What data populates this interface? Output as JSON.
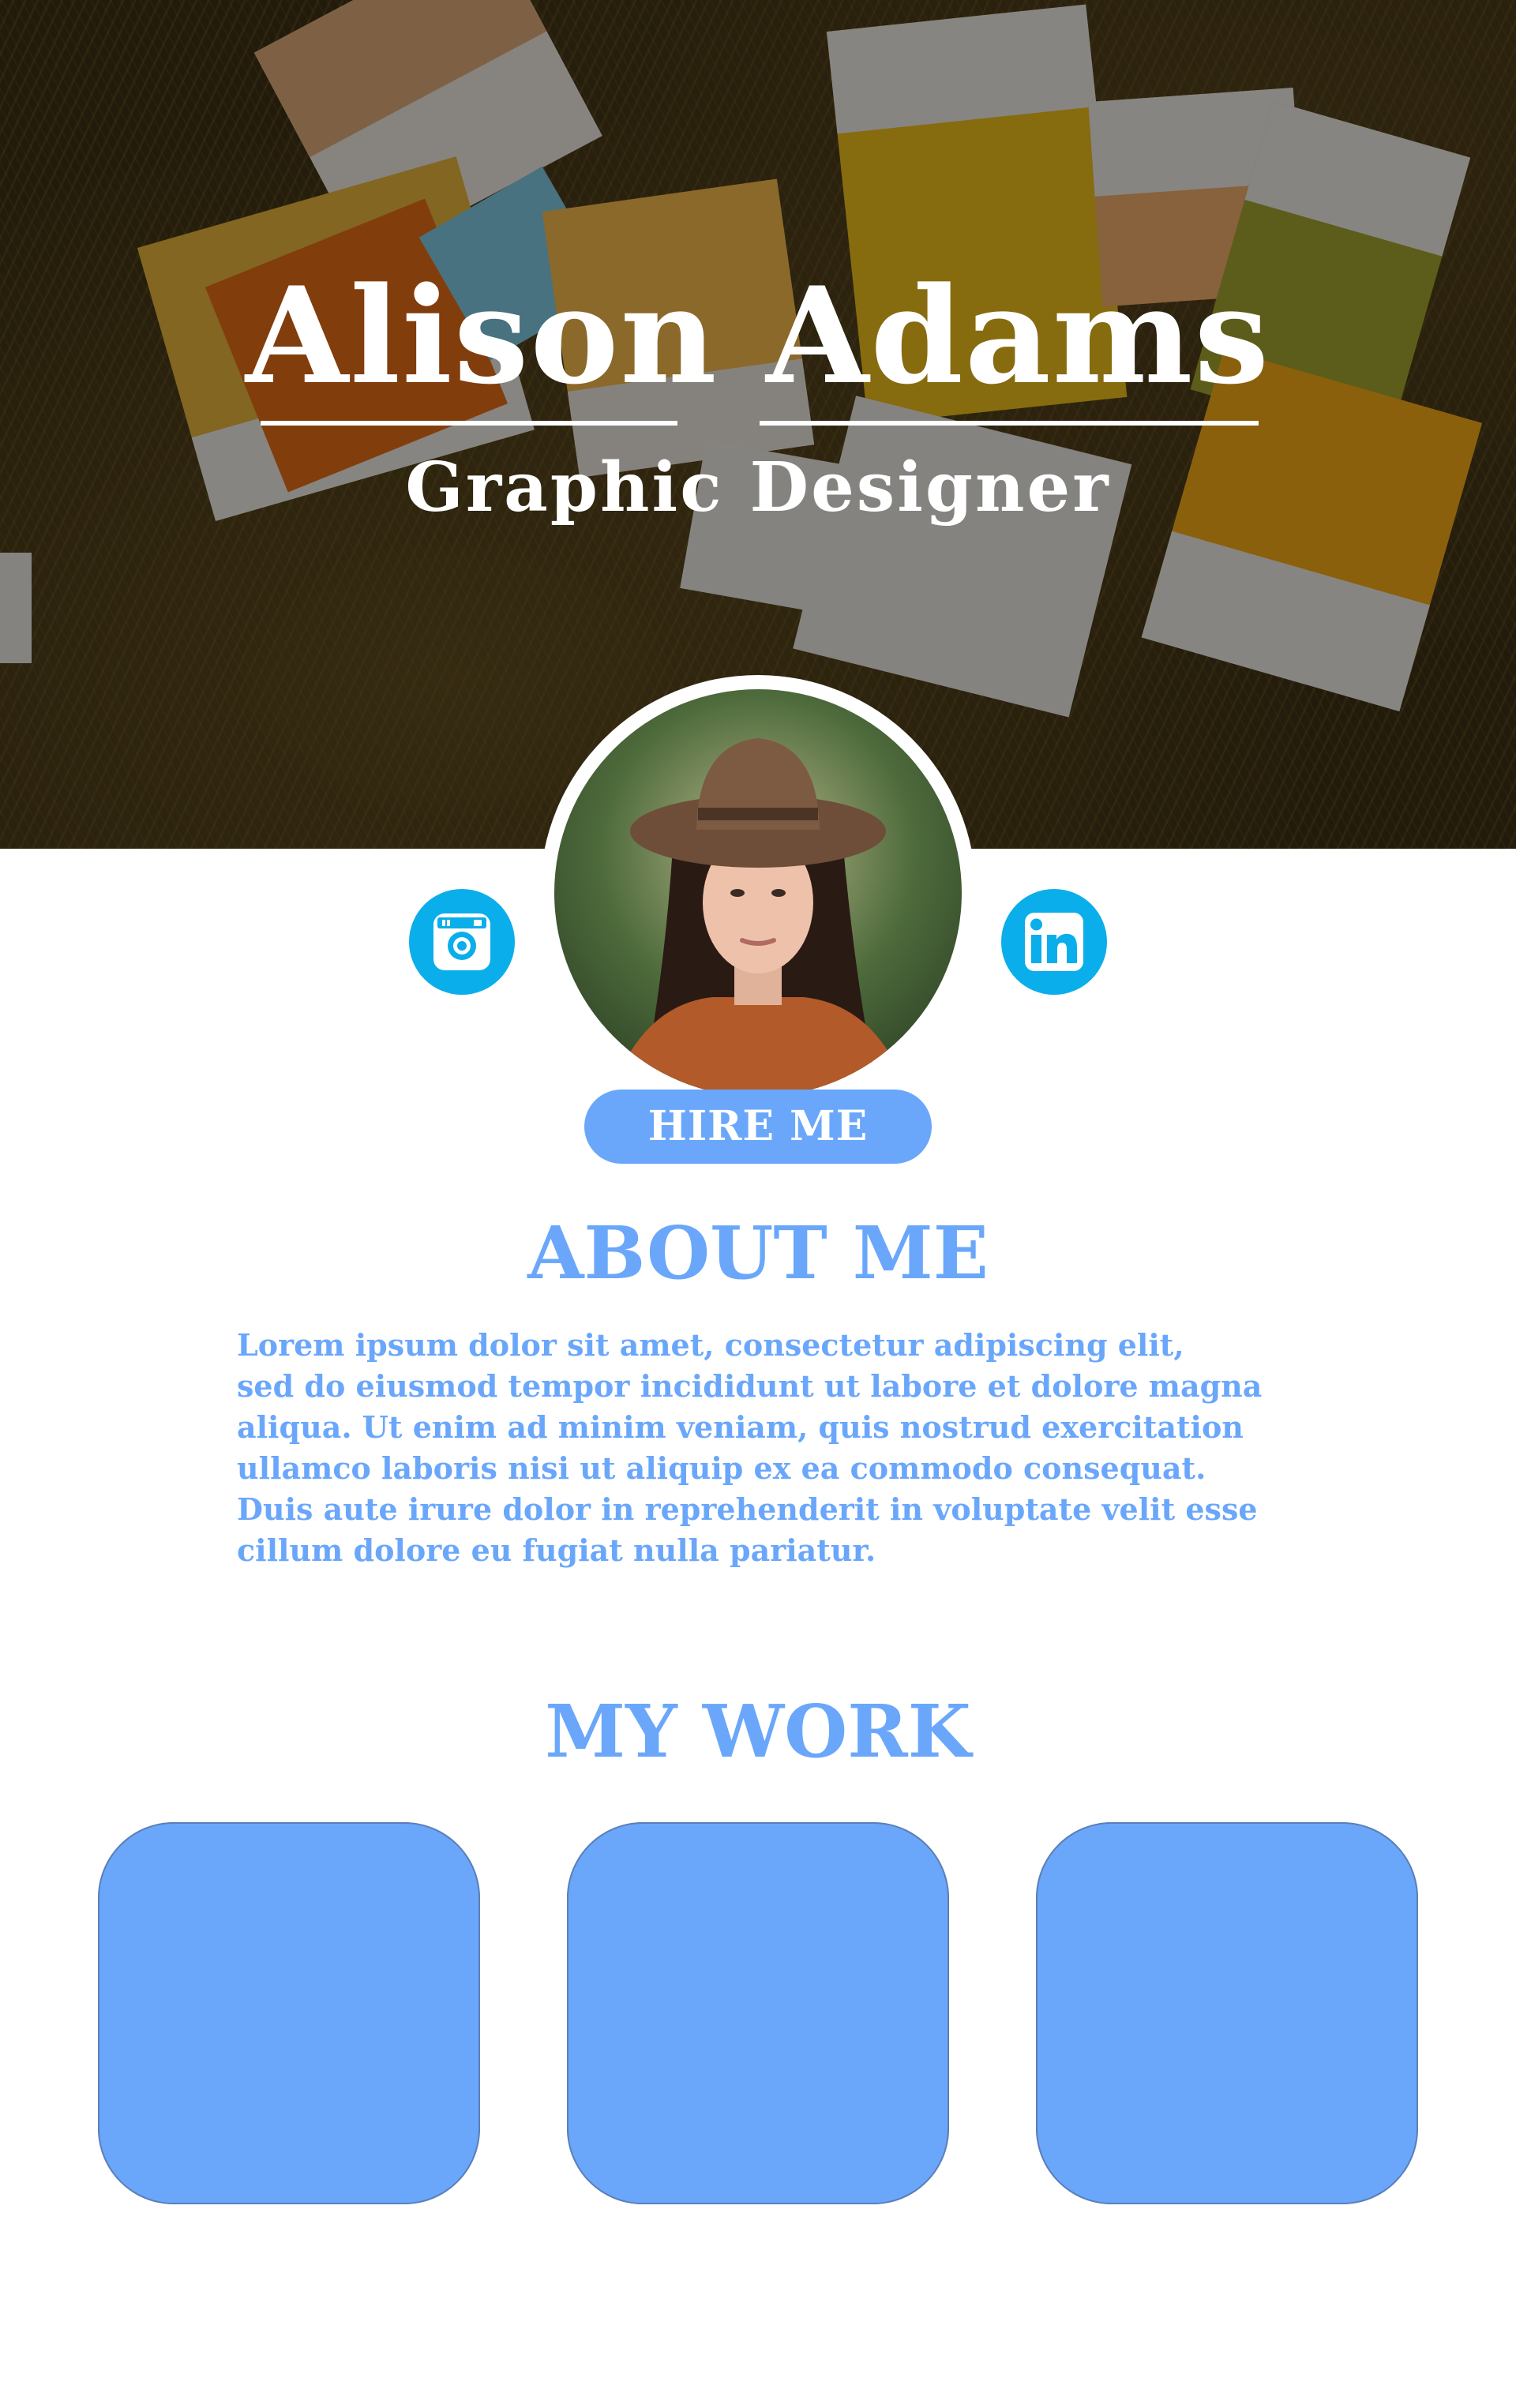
{
  "hero": {
    "name": "Alison Adams",
    "role": "Graphic Designer"
  },
  "social": {
    "links": [
      {
        "name": "instagram",
        "icon": "instagram-icon"
      },
      {
        "name": "linkedin",
        "icon": "linkedin-icon"
      }
    ],
    "color": "#0aaeea"
  },
  "hire": {
    "label": "HIRE ME"
  },
  "about": {
    "heading": "ABOUT ME",
    "lines": [
      "Lorem ipsum dolor sit amet, consectetur adipiscing elit,",
      "sed do eiusmod tempor incididunt ut labore et dolore magna",
      "aliqua. Ut enim ad minim veniam, quis nostrud exercitation",
      "ullamco laboris nisi ut aliquip ex ea commodo consequat.",
      "Duis aute irure dolor in reprehenderit in voluptate velit esse",
      "cillum dolore eu fugiat nulla pariatur."
    ]
  },
  "work": {
    "heading": "MY WORK",
    "tile_count": 3
  },
  "colors": {
    "accent": "#6aa7fb",
    "social": "#0aaeea",
    "hero_text": "#ffffff"
  }
}
